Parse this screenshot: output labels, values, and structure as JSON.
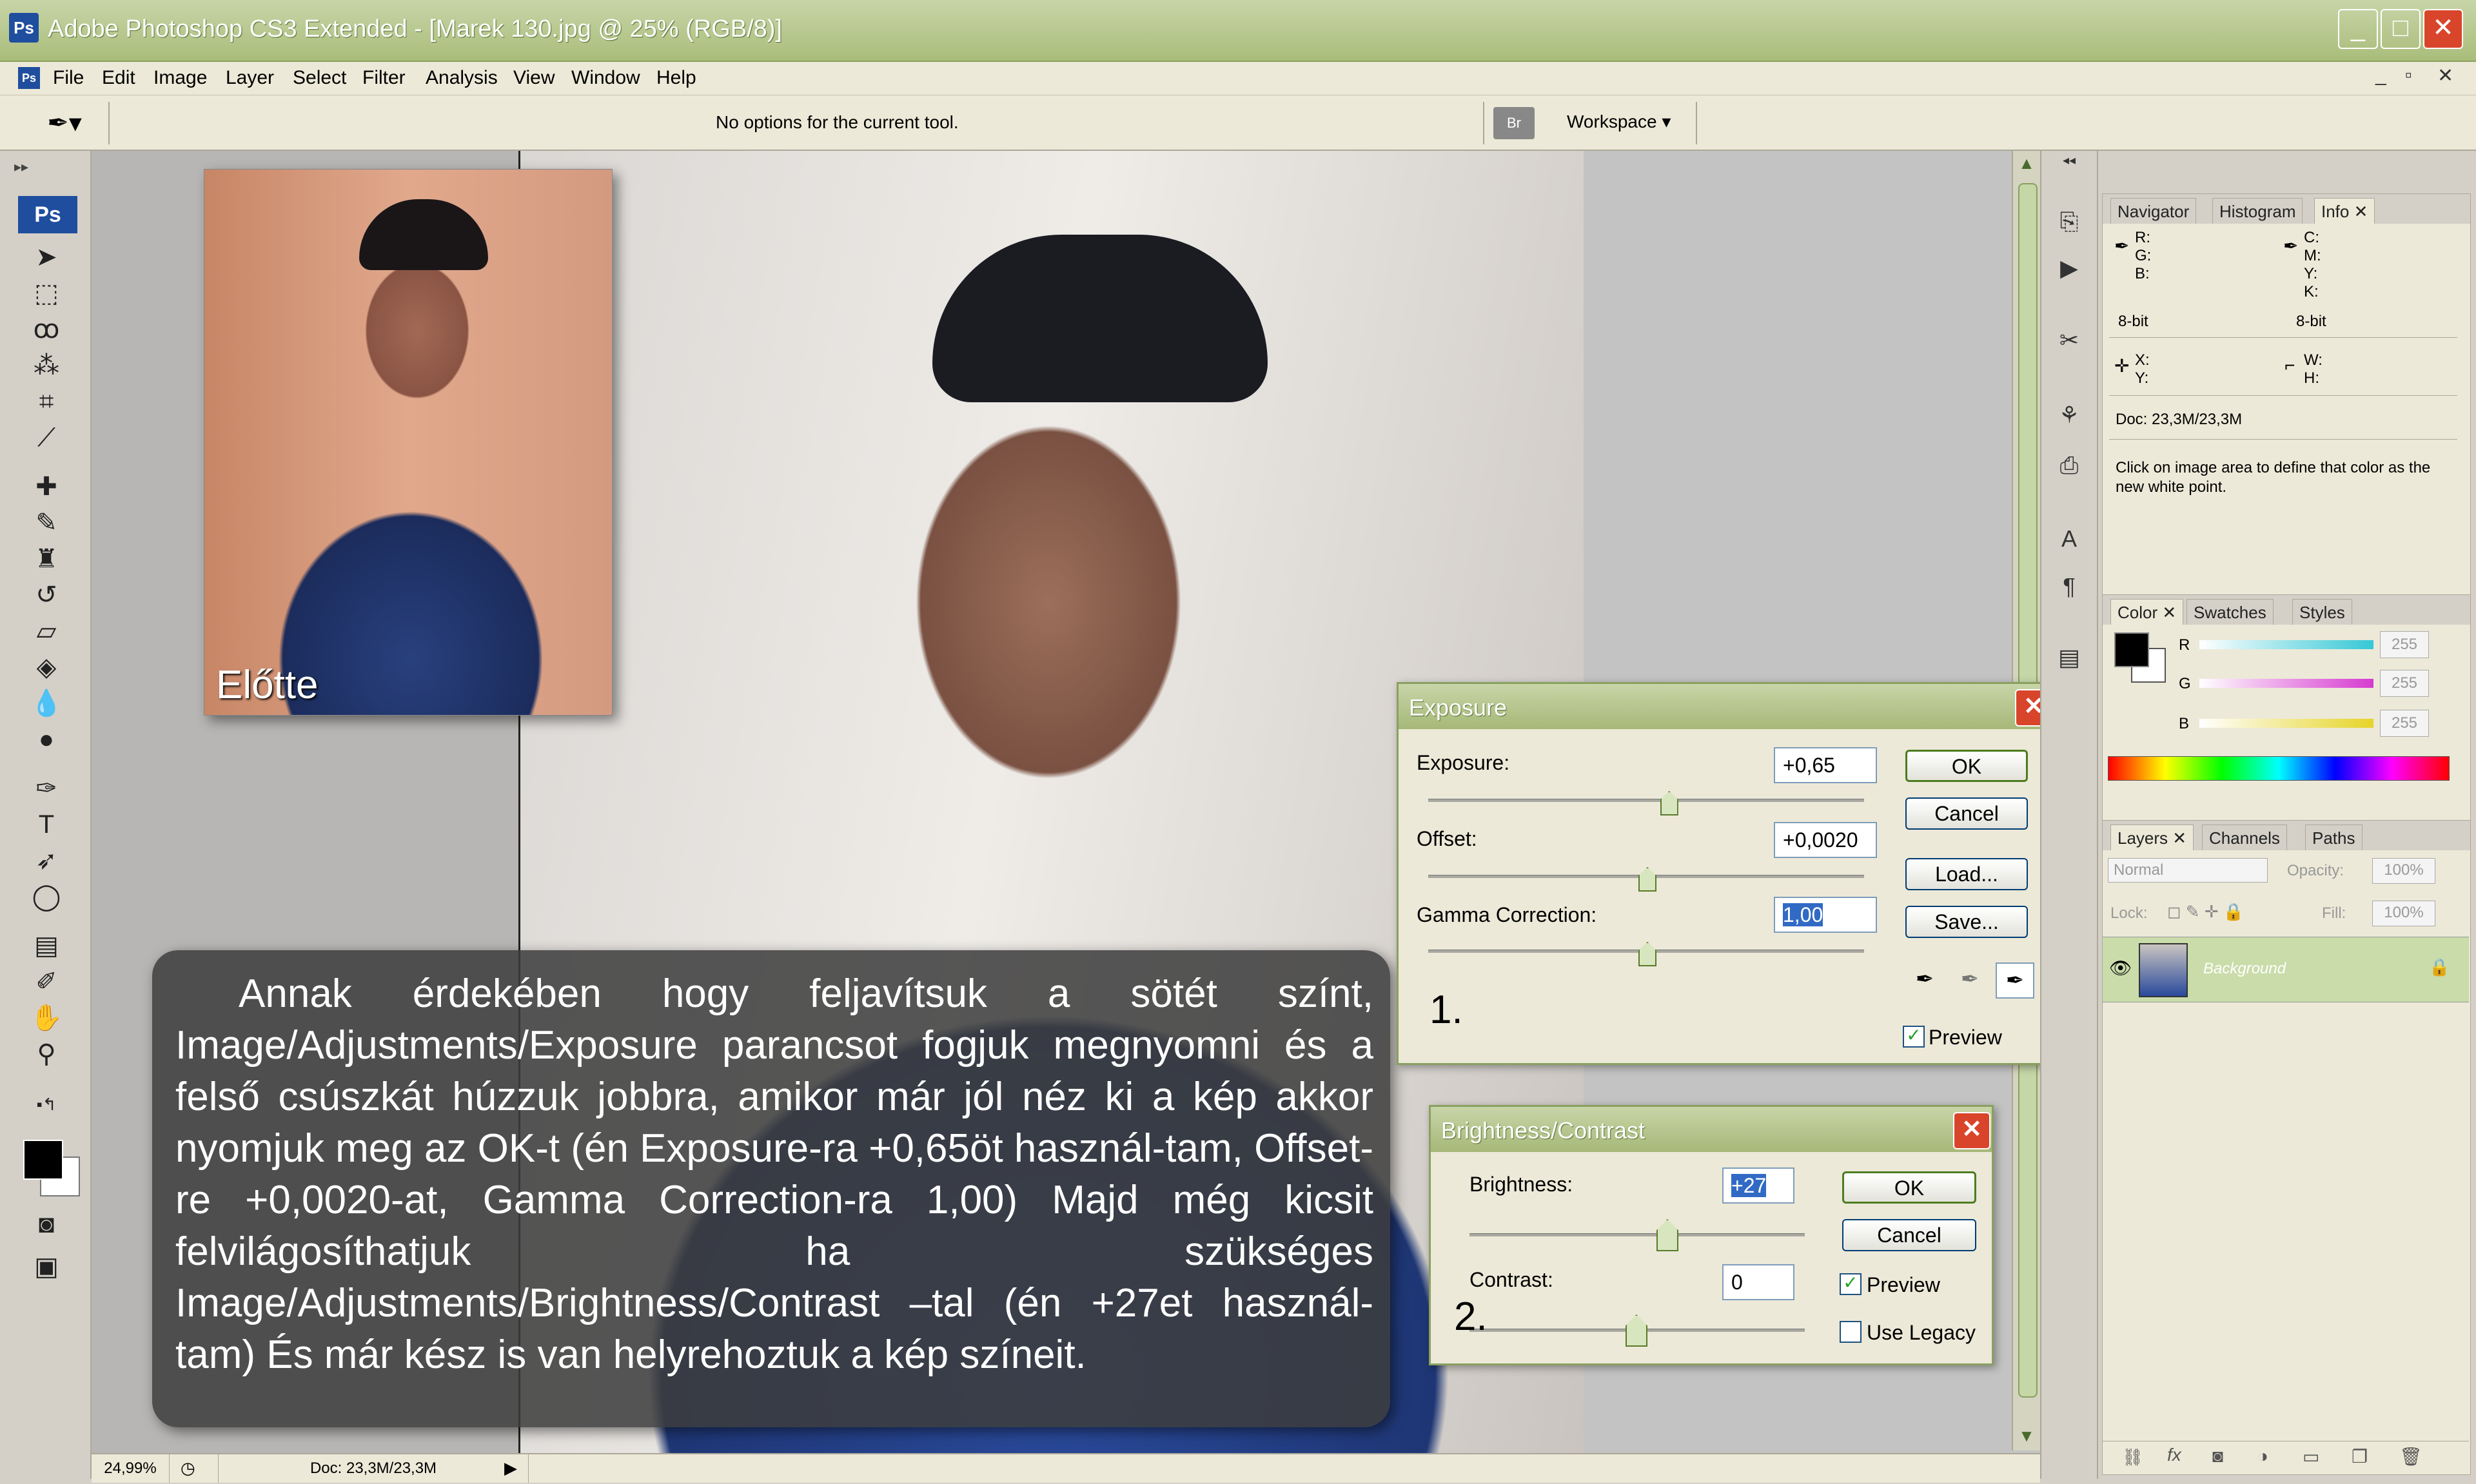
{
  "window": {
    "title": "Adobe Photoshop CS3 Extended - [Marek 130.jpg @ 25% (RGB/8)]",
    "app_badge": "Ps",
    "controls": [
      "_",
      "□",
      "✕"
    ]
  },
  "menubar": {
    "items": [
      "File",
      "Edit",
      "Image",
      "Layer",
      "Select",
      "Filter",
      "Analysis",
      "View",
      "Window",
      "Help"
    ],
    "doc_controls": [
      "_",
      "▫",
      "✕"
    ]
  },
  "options_bar": {
    "tool_icon": "eyedropper-icon",
    "message": "No options for the current tool.",
    "bridge_label": "Br",
    "workspace_label": "Workspace ▾"
  },
  "toolbox": {
    "logo": "Ps",
    "tools": [
      "move-icon",
      "marquee-icon",
      "lasso-icon",
      "magic-wand-icon",
      "crop-icon",
      "slice-icon",
      "healing-icon",
      "brush-icon",
      "clone-stamp-icon",
      "history-brush-icon",
      "eraser-icon",
      "paint-bucket-icon",
      "blur-icon",
      "dodge-icon",
      "pen-icon",
      "type-icon",
      "path-select-icon",
      "shape-icon",
      "notes-icon",
      "eyedropper-tool-icon",
      "hand-icon",
      "zoom-icon"
    ]
  },
  "document": {
    "before_label": "Előtte",
    "caption": "Annak érdekében hogy feljavítsuk  a sötét színt, Image/Adjustments/Exposure parancsot fogjuk megnyomni és a felső csúszkát húzzuk jobbra, amikor már jól néz ki a kép akkor nyomjuk meg az OK-t (én Exposure-ra +0,65öt használ-tam, Offset-re +0,0020-at, Gamma Correction-ra 1,00) Majd még kicsit felvilágosíthatjuk ha szükséges Image/Adjustments/Brightness/Contrast –tal (én +27et használ-tam) És már kész is van helyrehoztuk a kép színeit."
  },
  "exposure_dialog": {
    "title": "Exposure",
    "close": "✕",
    "exposure_label": "Exposure:",
    "exposure_value": "+0,65",
    "exposure_slider": 0.55,
    "offset_label": "Offset:",
    "offset_value": "+0,0020",
    "offset_slider": 0.5,
    "gamma_label": "Gamma Correction:",
    "gamma_value": "1,00",
    "gamma_slider": 0.5,
    "buttons": {
      "ok": "OK",
      "cancel": "Cancel",
      "load": "Load...",
      "save": "Save..."
    },
    "preview_label": "Preview",
    "preview_checked": true,
    "step": "1."
  },
  "bc_dialog": {
    "title": "Brightness/Contrast",
    "close": "✕",
    "brightness_label": "Brightness:",
    "brightness_value": "+27",
    "contrast_label": "Contrast:",
    "contrast_value": "0",
    "buttons": {
      "ok": "OK",
      "cancel": "Cancel"
    },
    "preview_label": "Preview",
    "preview_checked": true,
    "legacy_label": "Use Legacy",
    "legacy_checked": false,
    "step": "2."
  },
  "info_panel": {
    "tabs": [
      "Navigator",
      "Histogram",
      "Info ✕"
    ],
    "rgb_labels": "R:\nG:\nB:",
    "cmyk_labels": "C:\nM:\nY:\nK:",
    "bit_left": "8-bit",
    "bit_right": "8-bit",
    "xy_labels": "X:\nY:",
    "wh_labels": "W:\nH:",
    "doc": "Doc: 23,3M/23,3M",
    "hint": "Click on image area to define that color as the new white point."
  },
  "color_panel": {
    "tabs": [
      "Color ✕",
      "Swatches",
      "Styles"
    ],
    "channels": [
      {
        "label": "R",
        "value": "255",
        "color": "#35c8d6"
      },
      {
        "label": "G",
        "value": "255",
        "color": "#d63ad0"
      },
      {
        "label": "B",
        "value": "255",
        "color": "#e6d428"
      }
    ]
  },
  "layers_panel": {
    "tabs": [
      "Layers ✕",
      "Channels",
      "Paths"
    ],
    "blend_mode": "Normal",
    "opacity_label": "Opacity:",
    "opacity_value": "100%",
    "lock_label": "Lock:",
    "fill_label": "Fill:",
    "fill_value": "100%",
    "layer_name": "Background",
    "footer_icons": [
      "link-icon",
      "fx-icon",
      "mask-icon",
      "adjustment-icon",
      "group-icon",
      "new-layer-icon",
      "trash-icon"
    ]
  },
  "status_bar": {
    "zoom": "24,99%",
    "doc": "Doc: 23,3M/23,3M"
  }
}
